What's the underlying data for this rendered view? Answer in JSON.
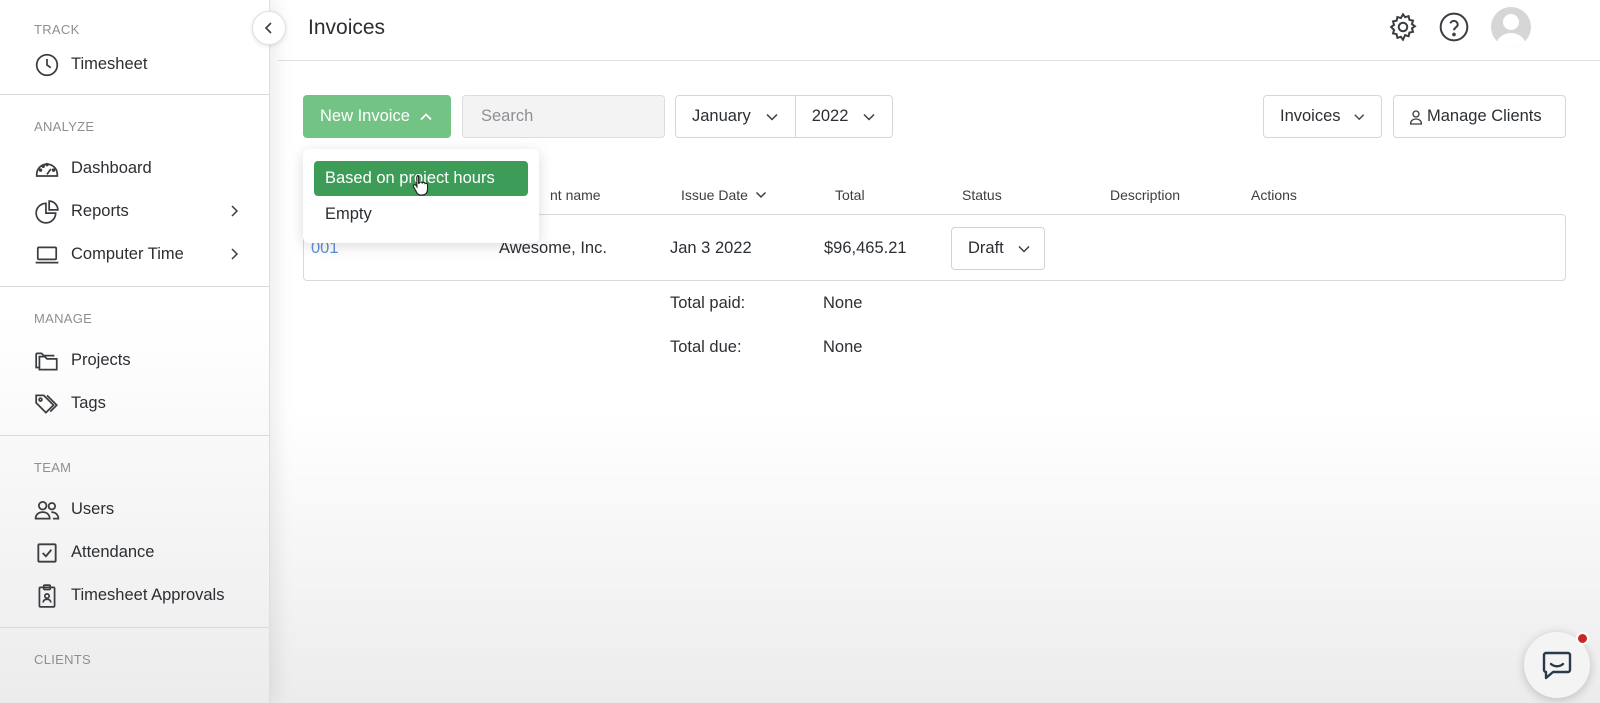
{
  "sidebar": {
    "sections": [
      {
        "heading": "TRACK",
        "items": [
          {
            "label": "Timesheet",
            "icon": "clock-icon"
          }
        ]
      },
      {
        "heading": "ANALYZE",
        "items": [
          {
            "label": "Dashboard",
            "icon": "gauge-icon"
          },
          {
            "label": "Reports",
            "icon": "pie-chart-icon"
          },
          {
            "label": "Computer Time",
            "icon": "laptop-icon"
          }
        ]
      },
      {
        "heading": "MANAGE",
        "items": [
          {
            "label": "Projects",
            "icon": "folders-icon"
          },
          {
            "label": "Tags",
            "icon": "tags-icon"
          }
        ]
      },
      {
        "heading": "TEAM",
        "items": [
          {
            "label": "Users",
            "icon": "users-icon"
          },
          {
            "label": "Attendance",
            "icon": "checkbox-icon"
          },
          {
            "label": "Timesheet Approvals",
            "icon": "clipboard-icon"
          }
        ]
      },
      {
        "heading": "CLIENTS",
        "items": []
      }
    ]
  },
  "header": {
    "title": "Invoices",
    "icons": [
      "gear-icon",
      "help-icon",
      "avatar"
    ]
  },
  "toolbar": {
    "new_invoice": "New Invoice",
    "search_placeholder": "Search",
    "month": "January",
    "year": "2022",
    "view": "Invoices",
    "manage_clients": "Manage Clients"
  },
  "dropdown": {
    "items": [
      "Based on project hours",
      "Empty"
    ],
    "active_index": 0
  },
  "table": {
    "columns": {
      "client": "nt name",
      "issue_date": "Issue Date",
      "total": "Total",
      "status": "Status",
      "description": "Description",
      "actions": "Actions"
    },
    "rows": [
      {
        "number": "001",
        "client": "Awesome, Inc.",
        "issue_date": "Jan 3 2022",
        "total": "$96,465.21",
        "status": "Draft"
      }
    ],
    "summary": {
      "paid_label": "Total paid:",
      "paid_value": "None",
      "due_label": "Total due:",
      "due_value": "None"
    }
  },
  "colors": {
    "primary_green": "#72c384",
    "active_green": "#3d9c58",
    "link_blue": "#5d8fd6",
    "badge_red": "#c62828"
  }
}
